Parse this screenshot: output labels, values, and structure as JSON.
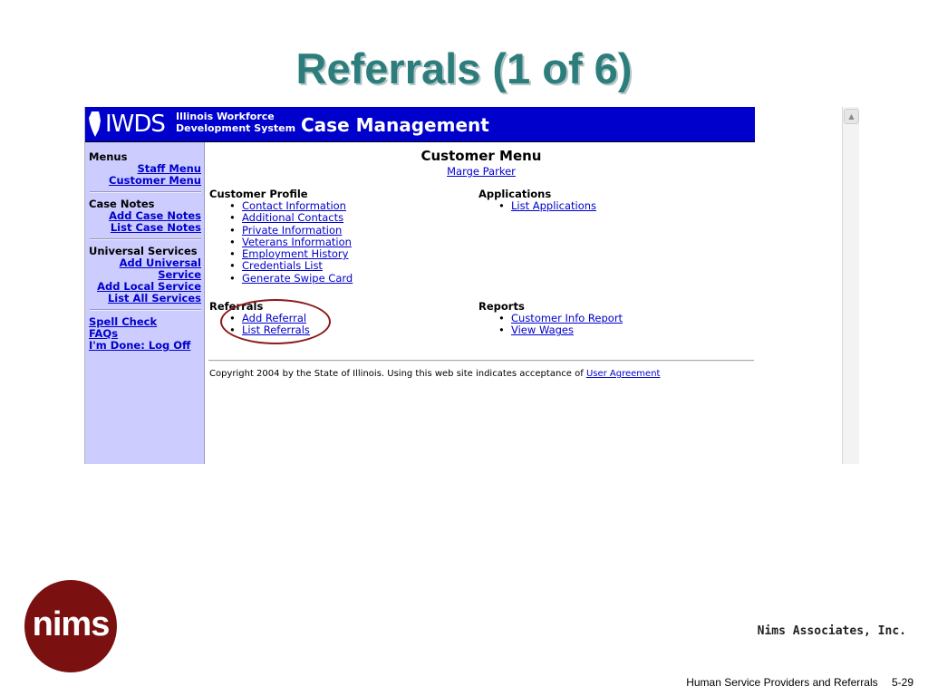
{
  "slide": {
    "title": "Referrals (1 of 6)",
    "company": "Nims Associates, Inc.",
    "footer_caption": "Human Service Providers and Referrals",
    "page_number": "5-29",
    "logo_text": "nims"
  },
  "banner": {
    "logo_text": "IWDS",
    "logo_sub_line1": "Illinois Workforce",
    "logo_sub_line2": "Development System",
    "app_title": "Case Management",
    "color": "#0000cc"
  },
  "sidebar": {
    "menus_head": "Menus",
    "staff_menu": "Staff Menu",
    "customer_menu": "Customer Menu",
    "case_notes_head": "Case Notes",
    "add_case_notes": "Add Case Notes",
    "list_case_notes": "List Case Notes",
    "universal_services_head": "Universal Services",
    "add_universal_line1": "Add Universal",
    "add_universal_line2": "Service",
    "add_local_service": "Add Local Service",
    "list_all_services": "List All Services",
    "spell_check": "Spell Check",
    "faqs": "FAQs",
    "log_off": "I'm Done: Log Off",
    "background": "#ccccff"
  },
  "main": {
    "menu_title": "Customer Menu",
    "customer_name": "Marge Parker",
    "customer_profile": {
      "heading": "Customer Profile",
      "items": [
        "Contact Information",
        "Additional Contacts",
        "Private Information",
        "Veterans Information",
        "Employment History",
        "Credentials List",
        "Generate Swipe Card"
      ]
    },
    "applications": {
      "heading": "Applications",
      "items": [
        "List Applications"
      ]
    },
    "referrals": {
      "heading": "Referrals",
      "items": [
        "Add Referral",
        "List Referrals"
      ]
    },
    "reports": {
      "heading": "Reports",
      "items": [
        "Customer Info Report",
        "View Wages"
      ]
    },
    "copyright_text": "Copyright 2004 by the State of Illinois. Using this web site indicates acceptance of",
    "user_agreement": "User Agreement"
  },
  "colors": {
    "title": "#2e7d7d",
    "link": "#0000cc",
    "highlight_ellipse": "#8b1a1a",
    "logo_circle": "#7a1010"
  }
}
